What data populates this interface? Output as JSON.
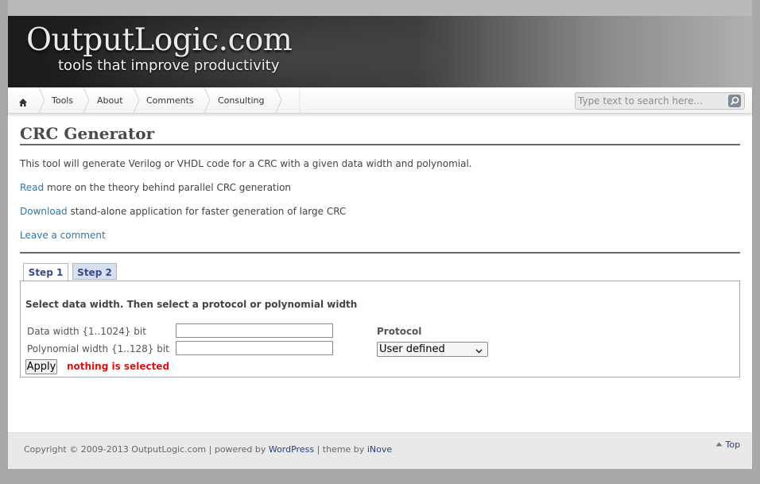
{
  "site": {
    "logo_text": "OutputLogic.com",
    "tagline": "tools that improve productivity"
  },
  "nav": {
    "home_icon": "home-icon",
    "items": [
      {
        "label": "Tools"
      },
      {
        "label": "About"
      },
      {
        "label": "Comments"
      },
      {
        "label": "Consulting"
      }
    ]
  },
  "search": {
    "placeholder": "Type text to search here...",
    "icon": "search-icon"
  },
  "page": {
    "title": "CRC Generator",
    "intro": "This tool will generate Verilog or VHDL code for a CRC with a given data width and polynomial.",
    "read_link": "Read",
    "read_text": " more on the theory behind parallel CRC generation",
    "download_link": "Download",
    "download_text": " stand-alone application for faster generation of large CRC",
    "comment_link": "Leave a comment"
  },
  "tabs": [
    {
      "label": "Step 1"
    },
    {
      "label": "Step 2"
    }
  ],
  "form": {
    "heading": "Select data width. Then select a protocol or polynomial width",
    "data_width_label": "Data width {1..1024} bit",
    "data_width_value": "",
    "poly_width_label": "Polynomial width {1..128} bit",
    "poly_width_value": "",
    "protocol_label": "Protocol",
    "protocol_selected": "User defined",
    "apply_label": "Apply",
    "status": "nothing is selected"
  },
  "footer": {
    "copyright": "Copyright © 2009-2013 OutputLogic.com | powered by ",
    "wordpress": "WordPress",
    "theme_sep": " | theme by ",
    "inove": "iNove",
    "top_label": "Top"
  },
  "colors": {
    "link": "#2a78b8",
    "status": "#e01010",
    "tab_active_text": "#3a4a8a"
  }
}
